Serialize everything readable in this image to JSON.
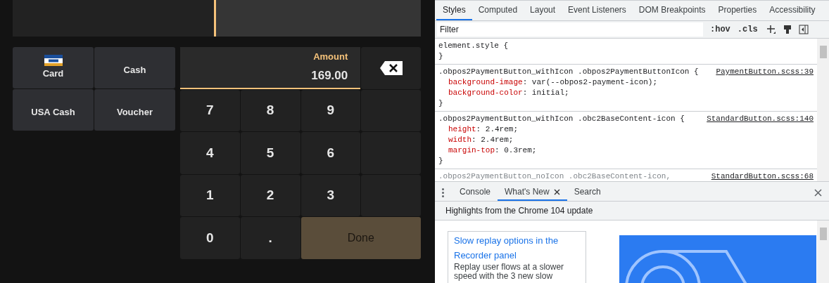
{
  "pos": {
    "payment_methods": [
      {
        "label": "Card",
        "kind": "icon"
      },
      {
        "label": "Cash",
        "kind": "plain"
      },
      {
        "label": "USA Cash",
        "kind": "plain"
      },
      {
        "label": "Voucher",
        "kind": "plain"
      }
    ],
    "amount": {
      "label": "Amount",
      "value": "169.00"
    },
    "keys": [
      {
        "label": "7"
      },
      {
        "label": "8"
      },
      {
        "label": "9"
      },
      {
        "label": "4"
      },
      {
        "label": "5"
      },
      {
        "label": "6"
      },
      {
        "label": "1"
      },
      {
        "label": "2"
      },
      {
        "label": "3"
      },
      {
        "label": "0"
      },
      {
        "label": "."
      }
    ],
    "done": {
      "label": "Done",
      "disabled": true
    }
  },
  "devtools": {
    "tabs": [
      {
        "label": "Styles",
        "selected": true
      },
      {
        "label": "Computed",
        "selected": false
      },
      {
        "label": "Layout",
        "selected": false
      },
      {
        "label": "Event Listeners",
        "selected": false
      },
      {
        "label": "DOM Breakpoints",
        "selected": false
      },
      {
        "label": "Properties",
        "selected": false
      },
      {
        "label": "Accessibility",
        "selected": false
      }
    ],
    "filter": {
      "placeholder": "Filter"
    },
    "toolbar": [
      ":hov",
      ".cls"
    ],
    "rules": [
      {
        "selector": "element.style {",
        "inactive": false,
        "closing": "}"
      },
      {
        "selector": ".obpos2PaymentButton_withIcon .obpos2PaymentButtonIcon {",
        "source": "PaymentButton.scss:39",
        "inactive": false,
        "declarations": [
          {
            "property": "background-image",
            "rest": ": var(--obpos2-payment-icon);"
          },
          {
            "property": "background-color",
            "rest": ": initial;"
          }
        ],
        "closing": "}"
      },
      {
        "selector": ".obpos2PaymentButton_withIcon .obc2BaseContent-icon {",
        "source": "StandardButton.scss:140",
        "inactive": false,
        "declarations": [
          {
            "property": "height",
            "rest": ": 2.4rem;"
          },
          {
            "property": "width",
            "rest": ": 2.4rem;"
          },
          {
            "property": "margin-top",
            "rest": ": 0.3rem;"
          }
        ],
        "closing": "}"
      },
      {
        "selector": ".obpos2PaymentButton_noIcon .obc2BaseContent-icon,",
        "source": "StandardButton.scss:68",
        "inactive": true
      }
    ],
    "drawer_tabs": [
      {
        "label": "Console",
        "selected": false,
        "closable": false
      },
      {
        "label": "What's New",
        "selected": true,
        "closable": true
      },
      {
        "label": "Search",
        "selected": false,
        "closable": false
      }
    ],
    "highlights": "Highlights from the Chrome 104 update",
    "card": {
      "title": "Slow replay options in the Recorder panel",
      "text": "Replay user flows at a slower speed with the 3 new slow"
    }
  }
}
